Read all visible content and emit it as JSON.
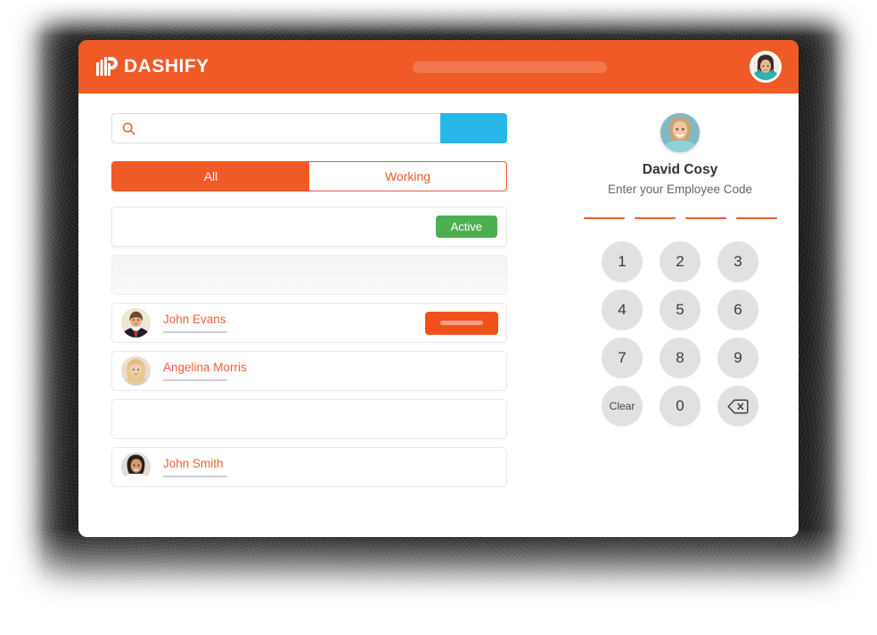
{
  "colors": {
    "brand_orange": "#ef5a27",
    "accent_blue": "#29b6e8",
    "status_green": "#4cb050",
    "name_orange": "#f4603a",
    "key_gray": "#e1e1e1"
  },
  "header": {
    "logo_text": "DASHIFY",
    "logo_icon": "dashify-bars-d-logo",
    "placeholder_bar": "",
    "avatar_icon": "user-avatar-female"
  },
  "search": {
    "icon": "search-icon",
    "value": "",
    "placeholder": "",
    "button_label": ""
  },
  "tabs": [
    {
      "label": "All",
      "active": true
    },
    {
      "label": "Working",
      "active": false
    }
  ],
  "list": {
    "rows": [
      {
        "type": "badge",
        "name": "",
        "badge": "Active"
      },
      {
        "type": "ghost",
        "name": ""
      },
      {
        "type": "person",
        "name": "John Evans",
        "avatar": "avatar-man-suit-red-tie",
        "button": true
      },
      {
        "type": "person",
        "name": "Angelina Morris",
        "avatar": "avatar-woman-blonde",
        "button": false
      },
      {
        "type": "empty",
        "name": ""
      },
      {
        "type": "person",
        "name": "John Smith",
        "avatar": "avatar-man-curly-hair",
        "button": false
      }
    ]
  },
  "login": {
    "avatar_icon": "avatar-david-cosy",
    "name": "David Cosy",
    "hint": "Enter your Employee Code",
    "pin_slots": 4,
    "pin_value": ""
  },
  "keypad": {
    "keys": [
      {
        "label": "1",
        "kind": "digit"
      },
      {
        "label": "2",
        "kind": "digit"
      },
      {
        "label": "3",
        "kind": "digit"
      },
      {
        "label": "4",
        "kind": "digit"
      },
      {
        "label": "5",
        "kind": "digit"
      },
      {
        "label": "6",
        "kind": "digit"
      },
      {
        "label": "7",
        "kind": "digit"
      },
      {
        "label": "8",
        "kind": "digit"
      },
      {
        "label": "9",
        "kind": "digit"
      },
      {
        "label": "Clear",
        "kind": "clear"
      },
      {
        "label": "0",
        "kind": "digit"
      },
      {
        "label": "",
        "kind": "backspace",
        "icon": "backspace-icon"
      }
    ]
  }
}
